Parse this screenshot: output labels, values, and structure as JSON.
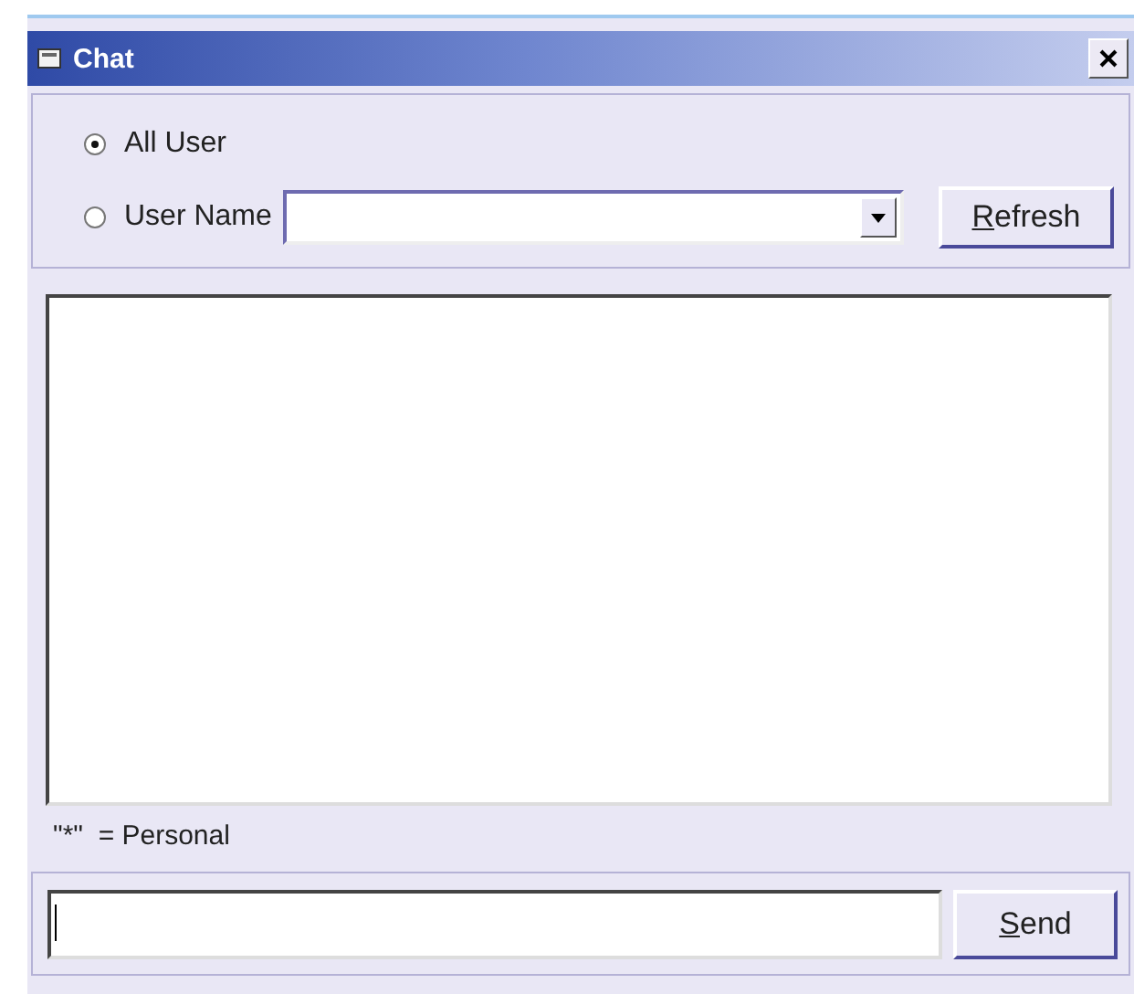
{
  "window": {
    "title": "Chat"
  },
  "recipient": {
    "options": [
      {
        "label": "All User",
        "selected": true
      },
      {
        "label": "User Name",
        "selected": false
      }
    ],
    "refresh_button": {
      "label": "Refresh"
    }
  },
  "legend": "\"*\"  = Personal",
  "send_button": {
    "label": "Send"
  }
}
